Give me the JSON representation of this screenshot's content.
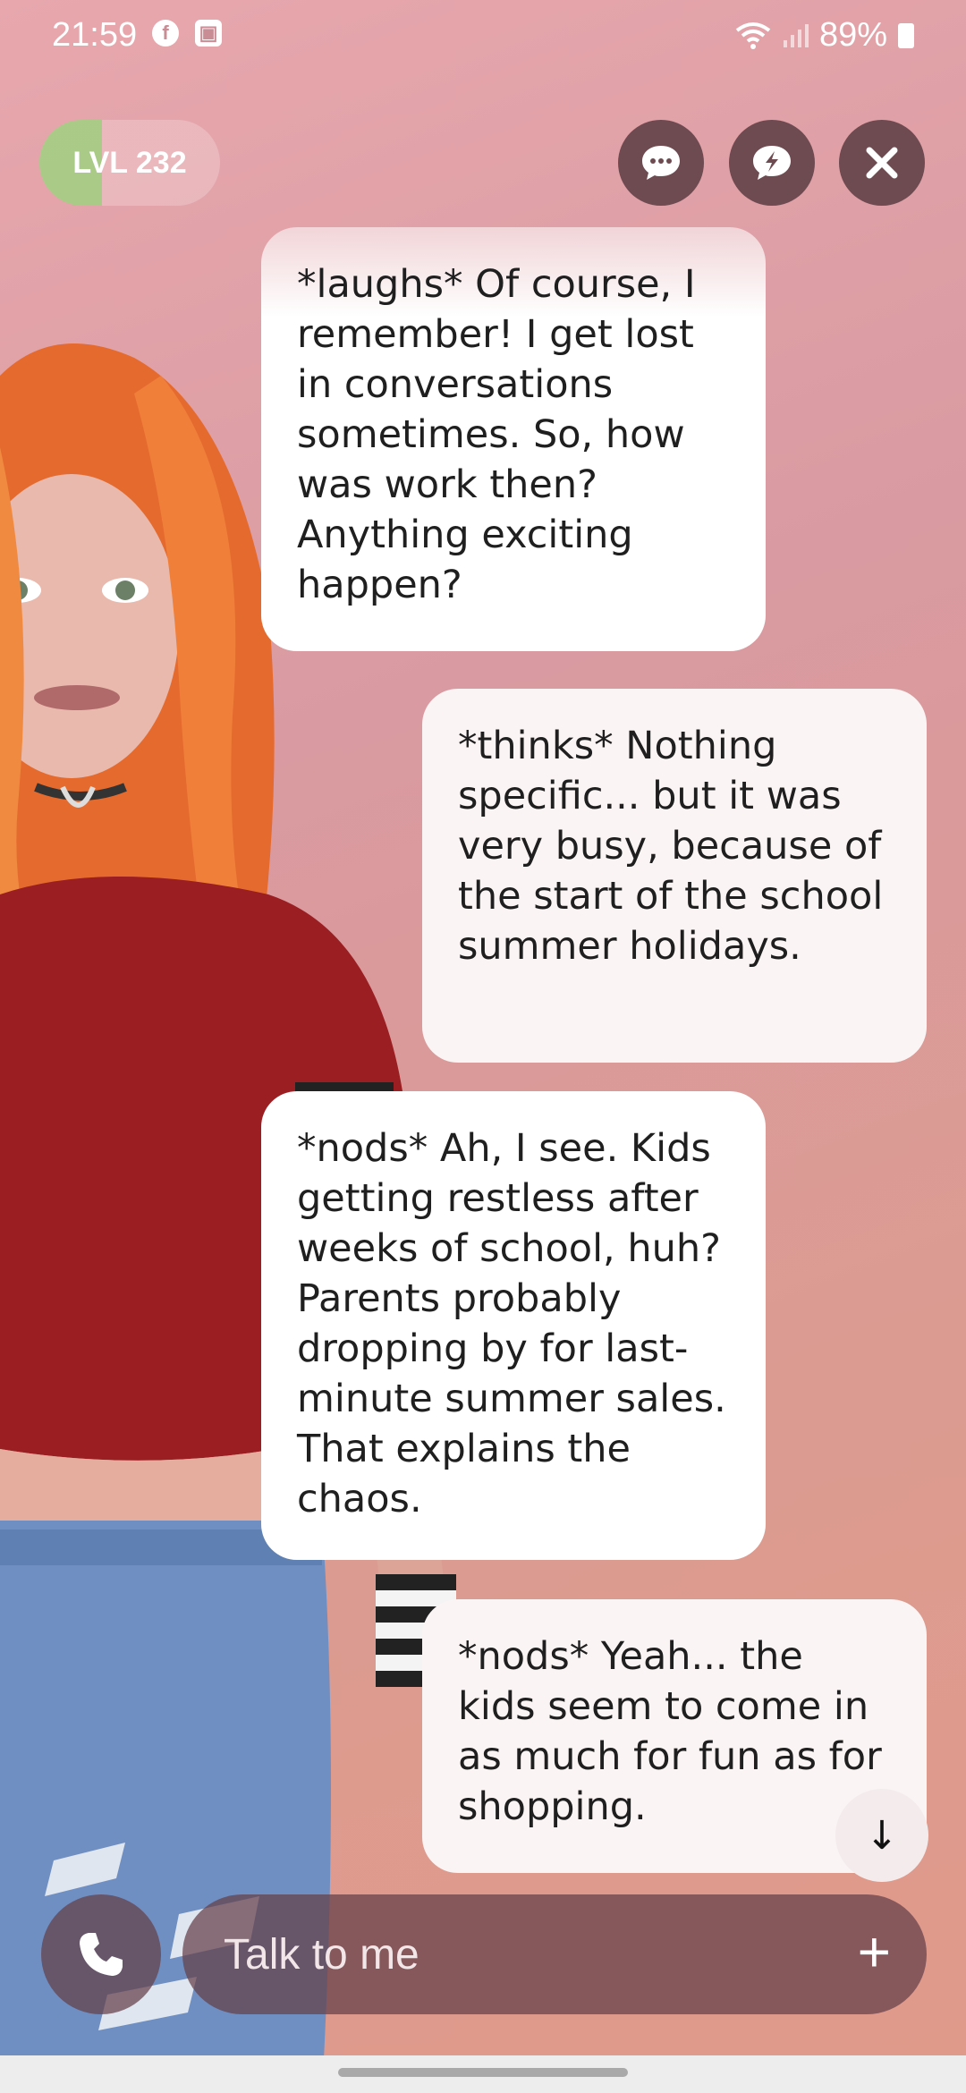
{
  "status_bar": {
    "time": "21:59",
    "battery": "89%"
  },
  "header": {
    "level_label": "LVL 232"
  },
  "messages": [
    {
      "role": "ai",
      "text": "*laughs* Of course, I remember! I get lost in conversations sometimes. So, how was work then? Anything exciting happen?"
    },
    {
      "role": "user",
      "text": "*thinks* Nothing specific... but it was very busy, because of the start of the school summer holidays."
    },
    {
      "role": "ai",
      "text": "*nods* Ah, I see. Kids getting restless after weeks of school, huh? Parents probably dropping by for last-minute summer sales. That explains the chaos."
    },
    {
      "role": "user",
      "text": "*nods* Yeah... the kids seem to come in as much for fun as for shopping."
    }
  ],
  "composer": {
    "placeholder": "Talk to me"
  },
  "colors": {
    "accent_level": "#a0d282",
    "button_bg": "#6e4a51",
    "bubble_bg": "#ffffff"
  },
  "icons": [
    "facebook-icon",
    "notification-icon",
    "wifi-icon",
    "signal-icon",
    "battery-icon",
    "chat-bubble-icon",
    "lightning-chat-icon",
    "close-icon",
    "arrow-down-icon",
    "phone-icon",
    "plus-icon"
  ]
}
